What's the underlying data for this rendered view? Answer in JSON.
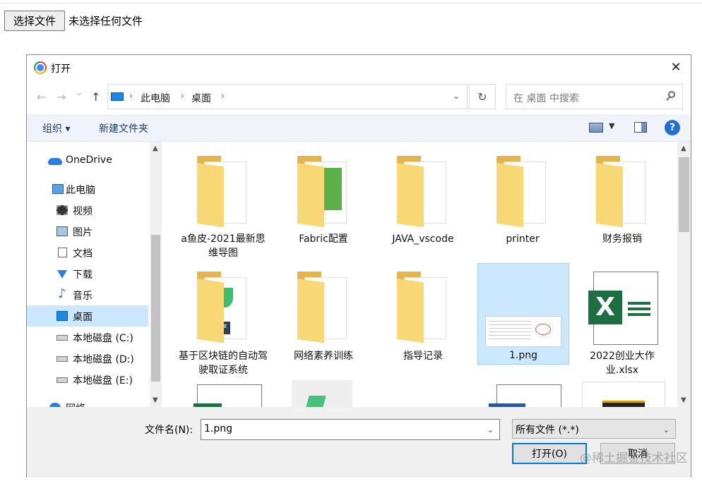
{
  "page": {
    "file_button_label": "选择文件",
    "file_status": "未选择任何文件"
  },
  "dialog": {
    "title": "打开",
    "nav": {
      "back": "←",
      "forward": "→",
      "recent": "⌄",
      "up": "↑",
      "crumbs": [
        "此电脑",
        "桌面"
      ],
      "search_placeholder": "在 桌面 中搜索"
    },
    "toolbar": {
      "organize": "组织 ▾",
      "new_folder": "新建文件夹",
      "help": "?"
    },
    "sidebar": {
      "items": [
        {
          "label": "OneDrive",
          "icon": "onedrive-icon"
        },
        {
          "label": "此电脑",
          "icon": "computer-icon"
        },
        {
          "label": "视频",
          "icon": "video-icon"
        },
        {
          "label": "图片",
          "icon": "pictures-icon"
        },
        {
          "label": "文档",
          "icon": "documents-icon"
        },
        {
          "label": "下载",
          "icon": "downloads-icon"
        },
        {
          "label": "音乐",
          "icon": "music-icon"
        },
        {
          "label": "桌面",
          "icon": "desktop-icon",
          "selected": true
        },
        {
          "label": "本地磁盘 (C:)",
          "icon": "drive-icon"
        },
        {
          "label": "本地磁盘 (D:)",
          "icon": "drive-icon"
        },
        {
          "label": "本地磁盘 (E:)",
          "icon": "drive-icon"
        },
        {
          "label": "网络",
          "icon": "network-icon"
        }
      ]
    },
    "files": [
      {
        "name": "a鱼皮-2021最新思维导图",
        "kind": "folder"
      },
      {
        "name": "Fabric配置",
        "kind": "folder"
      },
      {
        "name": "JAVA_vscode",
        "kind": "folder"
      },
      {
        "name": "printer",
        "kind": "folder"
      },
      {
        "name": "财务报销",
        "kind": "folder"
      },
      {
        "name": "基于区块链的自动驾驶取证系统",
        "kind": "folder"
      },
      {
        "name": "网络素养训练",
        "kind": "folder"
      },
      {
        "name": "指导记录",
        "kind": "folder"
      },
      {
        "name": "1.png",
        "kind": "image",
        "selected": true
      },
      {
        "name": "2022创业大作业.xlsx",
        "kind": "excel"
      }
    ],
    "bottom": {
      "filename_label": "文件名(N):",
      "filename_value": "1.png",
      "filter_value": "所有文件 (*.*)",
      "open_button": "打开(O)",
      "cancel_button": "取消"
    }
  },
  "watermark": "@稀土掘金技术社区",
  "colors": {
    "selection": "#cce8ff",
    "accent": "#0078d7",
    "folder": "#f8d775"
  }
}
